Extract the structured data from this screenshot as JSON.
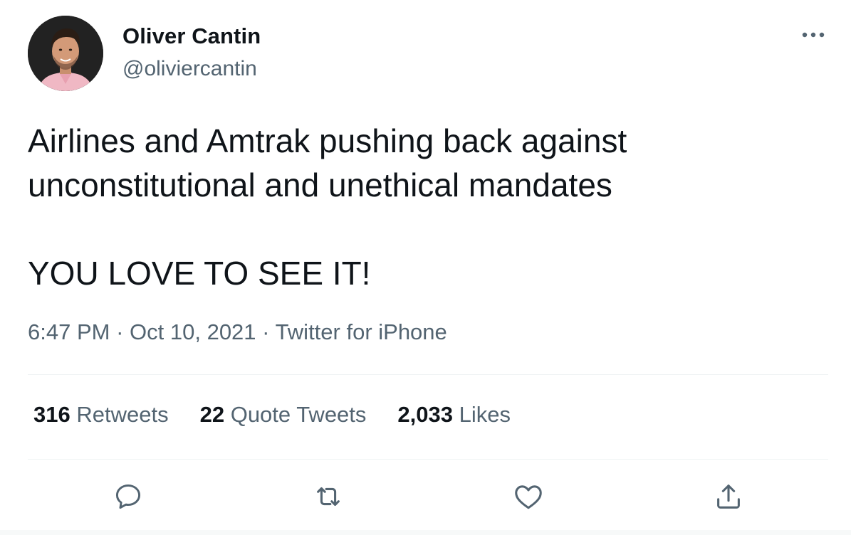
{
  "author": {
    "name": "Oliver Cantin",
    "handle": "@oliviercantin",
    "avatar": "profile-photo"
  },
  "tweet": {
    "lines": [
      "Airlines and Amtrak pushing back against",
      "unconstitutional and unethical mandates",
      "YOU LOVE TO SEE IT!"
    ]
  },
  "meta": {
    "time": "6:47 PM",
    "separator": "·",
    "date": "Oct 10, 2021",
    "source": "Twitter for iPhone"
  },
  "stats": {
    "retweets": {
      "count": "316",
      "label": "Retweets"
    },
    "quotes": {
      "count": "22",
      "label": "Quote Tweets"
    },
    "likes": {
      "count": "2,033",
      "label": "Likes"
    }
  },
  "actions": {
    "reply": "reply-icon",
    "retweet": "retweet-icon",
    "like": "heart-icon",
    "share": "share-icon",
    "more": "more-icon"
  },
  "colors": {
    "text": "#0f1419",
    "secondary": "#536471",
    "divider": "#eff3f4"
  }
}
